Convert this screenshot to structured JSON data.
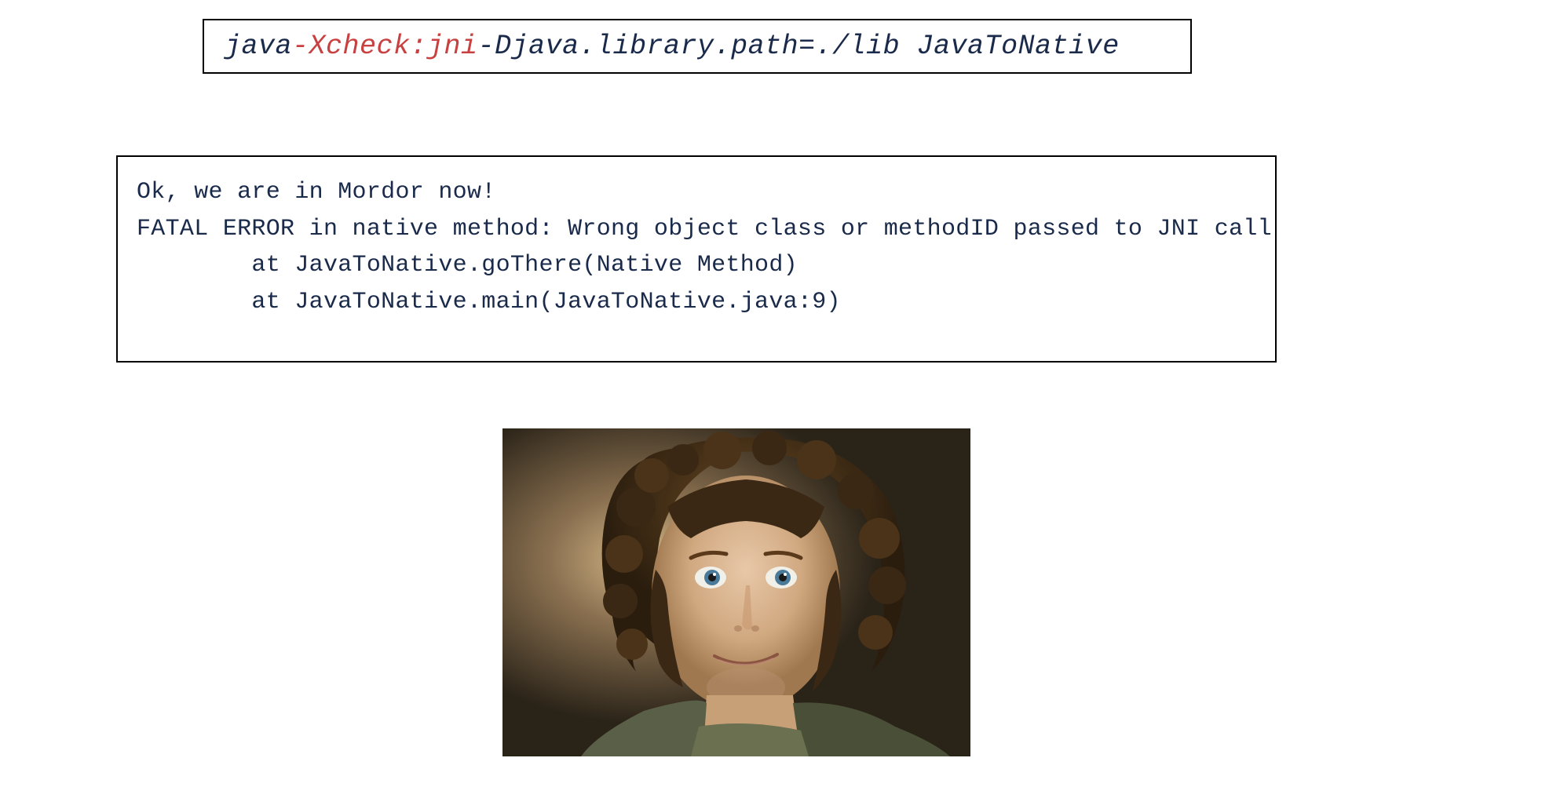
{
  "command": {
    "part1": "java ",
    "highlight": "-Xcheck:jni",
    "part2": " -Djava.library.path=./lib JavaToNative"
  },
  "output": {
    "line1": "Ok, we are in Mordor now!",
    "line2": "FATAL ERROR in native method: Wrong object class or methodID passed to JNI call",
    "line3": "        at JavaToNative.goThere(Native Method)",
    "line4": "        at JavaToNative.main(JavaToNative.java:9)"
  },
  "image": {
    "description": "frodo-smiling-image"
  }
}
